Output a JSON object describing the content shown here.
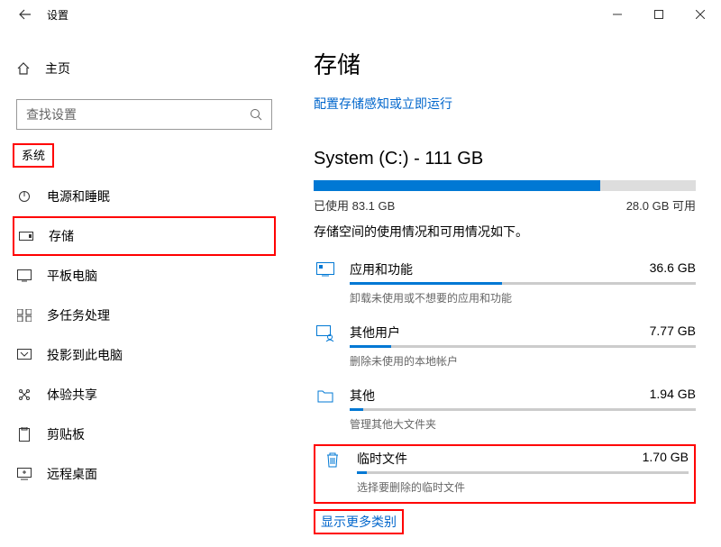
{
  "titlebar": {
    "title": "设置"
  },
  "sidebar": {
    "home": "主页",
    "search_placeholder": "查找设置",
    "section": "系统",
    "items": [
      {
        "label": "电源和睡眠"
      },
      {
        "label": "存储"
      },
      {
        "label": "平板电脑"
      },
      {
        "label": "多任务处理"
      },
      {
        "label": "投影到此电脑"
      },
      {
        "label": "体验共享"
      },
      {
        "label": "剪贴板"
      },
      {
        "label": "远程桌面"
      }
    ]
  },
  "content": {
    "title": "存储",
    "sense_link": "配置存储感知或立即运行",
    "drive_label": "System (C:) - 111 GB",
    "used_label": "已使用 83.1 GB",
    "free_label": "28.0 GB 可用",
    "desc": "存储空间的使用情况和可用情况如下。",
    "categories": [
      {
        "name": "应用和功能",
        "size": "36.6 GB",
        "sub": "卸载未使用或不想要的应用和功能",
        "pct": 44
      },
      {
        "name": "其他用户",
        "size": "7.77 GB",
        "sub": "删除未使用的本地帐户",
        "pct": 12
      },
      {
        "name": "其他",
        "size": "1.94 GB",
        "sub": "管理其他大文件夹",
        "pct": 4
      },
      {
        "name": "临时文件",
        "size": "1.70 GB",
        "sub": "选择要删除的临时文件",
        "pct": 3
      }
    ],
    "show_more": "显示更多类别"
  }
}
